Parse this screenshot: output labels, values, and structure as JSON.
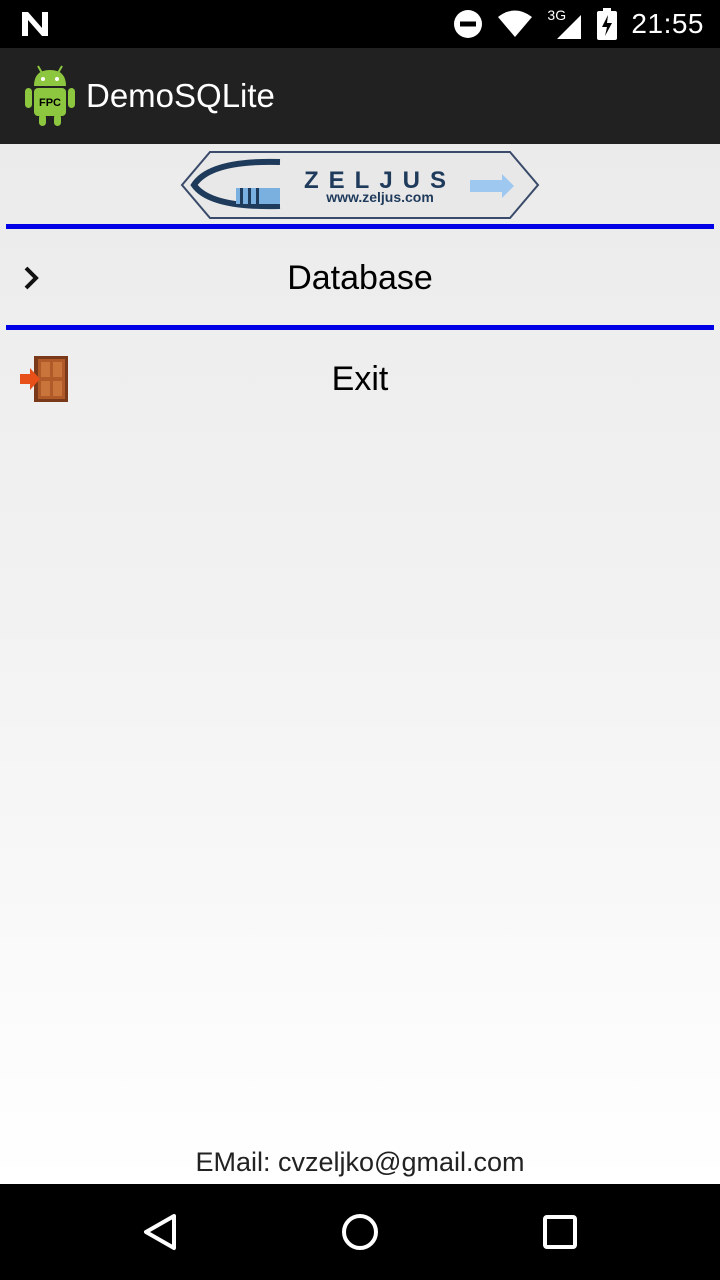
{
  "status_bar": {
    "time": "21:55",
    "network": "3G"
  },
  "app_bar": {
    "title": "DemoSQLite",
    "icon_label": "FPC"
  },
  "logo": {
    "brand": "ZELJUS",
    "url": "www.zeljus.com"
  },
  "menu": {
    "items": [
      {
        "label": "Database",
        "icon": "chevron-right-icon"
      },
      {
        "label": "Exit",
        "icon": "exit-door-icon"
      }
    ]
  },
  "footer": {
    "email": "EMail: cvzeljko@gmail.com"
  },
  "colors": {
    "divider": "#0000e6",
    "app_bar": "#212121"
  }
}
